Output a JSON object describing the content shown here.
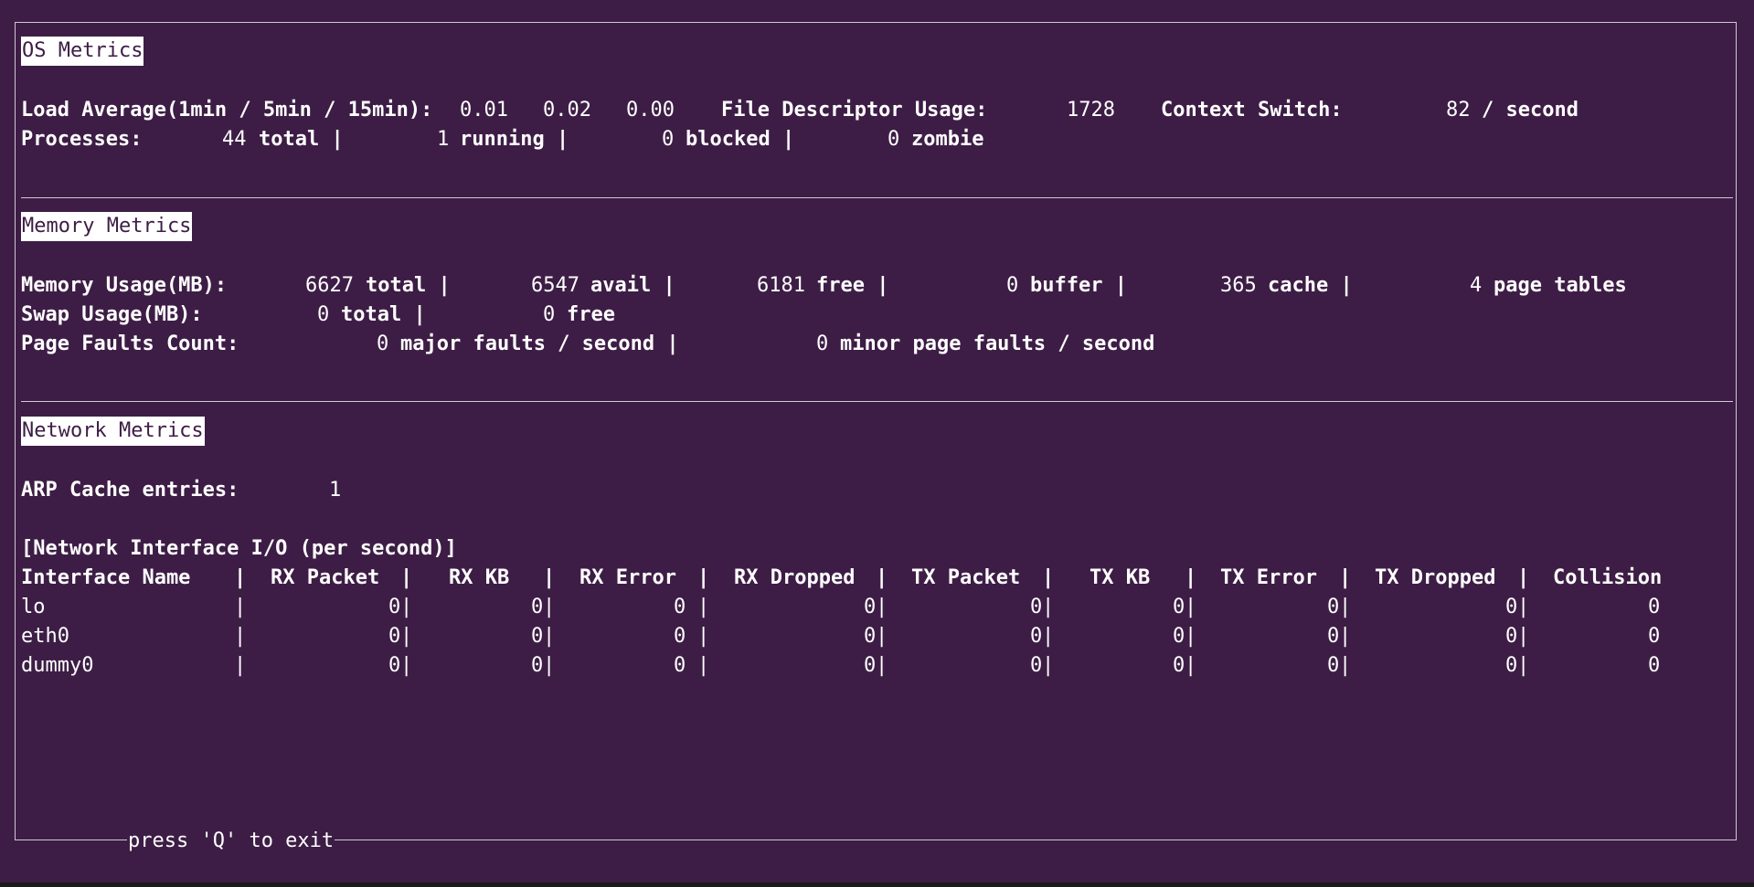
{
  "os": {
    "title": "OS Metrics",
    "load_label": "Load Average(1min / 5min / 15min):",
    "load_1": "0.01",
    "load_5": "0.02",
    "load_15": "0.00",
    "fd_label": "File Descriptor Usage:",
    "fd_value": "1728",
    "ctx_label": "Context Switch:",
    "ctx_value": "82",
    "ctx_unit": "/ second",
    "proc_label": "Processes:",
    "proc_total": "44",
    "proc_total_unit": "total |",
    "proc_running": "1",
    "proc_running_unit": "running |",
    "proc_blocked": "0",
    "proc_blocked_unit": "blocked |",
    "proc_zombie": "0",
    "proc_zombie_unit": "zombie"
  },
  "memory": {
    "title": "Memory Metrics",
    "usage_label": "Memory Usage(MB):",
    "total": "6627",
    "total_unit": "total |",
    "avail": "6547",
    "avail_unit": "avail |",
    "free": "6181",
    "free_unit": "free |",
    "buffer": "0",
    "buffer_unit": "buffer |",
    "cache": "365",
    "cache_unit": "cache |",
    "page_tables": "4",
    "page_tables_unit": "page tables",
    "swap_label": "Swap Usage(MB):",
    "swap_total": "0",
    "swap_total_unit": "total |",
    "swap_free": "0",
    "swap_free_unit": "free",
    "pf_label": "Page Faults Count:",
    "pf_major": "0",
    "pf_major_unit": "major faults / second |",
    "pf_minor": "0",
    "pf_minor_unit": "minor page faults / second"
  },
  "network": {
    "title": "Network Metrics",
    "arp_label": "ARP Cache entries:",
    "arp_value": "1",
    "io_heading": "[Network Interface I/O (per second)]",
    "columns": [
      "Interface Name",
      "RX Packet",
      "RX KB",
      "RX Error",
      "RX Dropped",
      "TX Packet",
      "TX KB",
      "TX Error",
      "TX Dropped",
      "Collision"
    ],
    "rows": [
      {
        "name": "lo",
        "values": [
          "0",
          "0",
          "0",
          "0",
          "0",
          "0",
          "0",
          "0",
          "0"
        ]
      },
      {
        "name": "eth0",
        "values": [
          "0",
          "0",
          "0",
          "0",
          "0",
          "0",
          "0",
          "0",
          "0"
        ]
      },
      {
        "name": "dummy0",
        "values": [
          "0",
          "0",
          "0",
          "0",
          "0",
          "0",
          "0",
          "0",
          "0"
        ]
      }
    ]
  },
  "footer": {
    "exit_hint": "press 'Q' to exit"
  },
  "colors": {
    "background": "#3d1d45",
    "text": "#ffffff",
    "border": "#cfc8d6"
  }
}
